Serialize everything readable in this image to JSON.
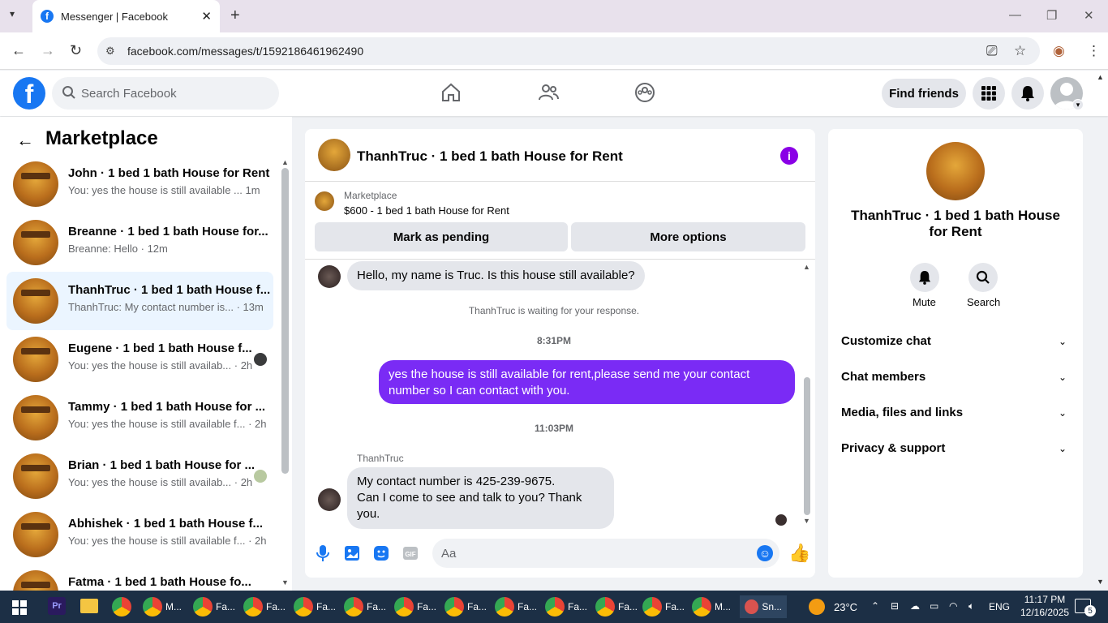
{
  "browser": {
    "tab_title": "Messenger | Facebook",
    "url": "facebook.com/messages/t/1592186461962490"
  },
  "header": {
    "search_placeholder": "Search Facebook",
    "find_friends": "Find friends"
  },
  "sidebar": {
    "title": "Marketplace",
    "conversations": [
      {
        "title": "John · 1 bed 1 bath House for Rent",
        "preview": "You: yes the house is still available ...",
        "time": "1m"
      },
      {
        "title": "Breanne · 1 bed 1 bath House for...",
        "preview": "Breanne: Hello",
        "time": "12m"
      },
      {
        "title": "ThanhTruc · 1 bed 1 bath House f...",
        "preview": "ThanhTruc: My contact number is...",
        "time": "13m"
      },
      {
        "title": "Eugene · 1 bed 1 bath House f...",
        "preview": "You: yes the house is still availab...",
        "time": "2h"
      },
      {
        "title": "Tammy · 1 bed 1 bath House for ...",
        "preview": "You: yes the house is still available f...",
        "time": "2h"
      },
      {
        "title": "Brian · 1 bed 1 bath House for ...",
        "preview": "You: yes the house is still availab...",
        "time": "2h"
      },
      {
        "title": "Abhishek · 1 bed 1 bath House f...",
        "preview": "You: yes the house is still available f...",
        "time": "2h"
      },
      {
        "title": "Fatma · 1 bed 1 bath House fo...",
        "preview": "",
        "time": ""
      }
    ]
  },
  "chat": {
    "title": "ThanhTruc · 1 bed 1 bath House for Rent",
    "listing_label": "Marketplace",
    "listing_price": "$600 - 1 bed 1 bath House for Rent",
    "mark_pending": "Mark as pending",
    "more_options": "More options",
    "msg1": "Hello, my name is Truc. Is this house still available?",
    "waiting_note": "ThanhTruc is waiting for your response.",
    "time1": "8:31PM",
    "msg2": "yes the house is still available for rent,please send me your contact number so I can contact with you.",
    "time2": "11:03PM",
    "sender_name": "ThanhTruc",
    "msg3_line1": "My contact number is 425-239-9675.",
    "msg3_line2": "Can I come to see and talk to you? Thank you.",
    "composer_placeholder": "Aa"
  },
  "details": {
    "title": "ThanhTruc · 1 bed 1 bath House for Rent",
    "mute": "Mute",
    "search": "Search",
    "sections": [
      "Customize chat",
      "Chat members",
      "Media, files and links",
      "Privacy & support"
    ]
  },
  "taskbar": {
    "apps": [
      "M...",
      "Fa...",
      "Fa...",
      "Fa...",
      "Fa...",
      "Fa...",
      "Fa...",
      "Fa...",
      "Fa...",
      "Fa...",
      "Fa...",
      "M...",
      "Sn..."
    ],
    "weather": "23°C",
    "lang": "ENG",
    "time": "11:17 PM",
    "date": "12/16/2025",
    "notif": "5"
  }
}
